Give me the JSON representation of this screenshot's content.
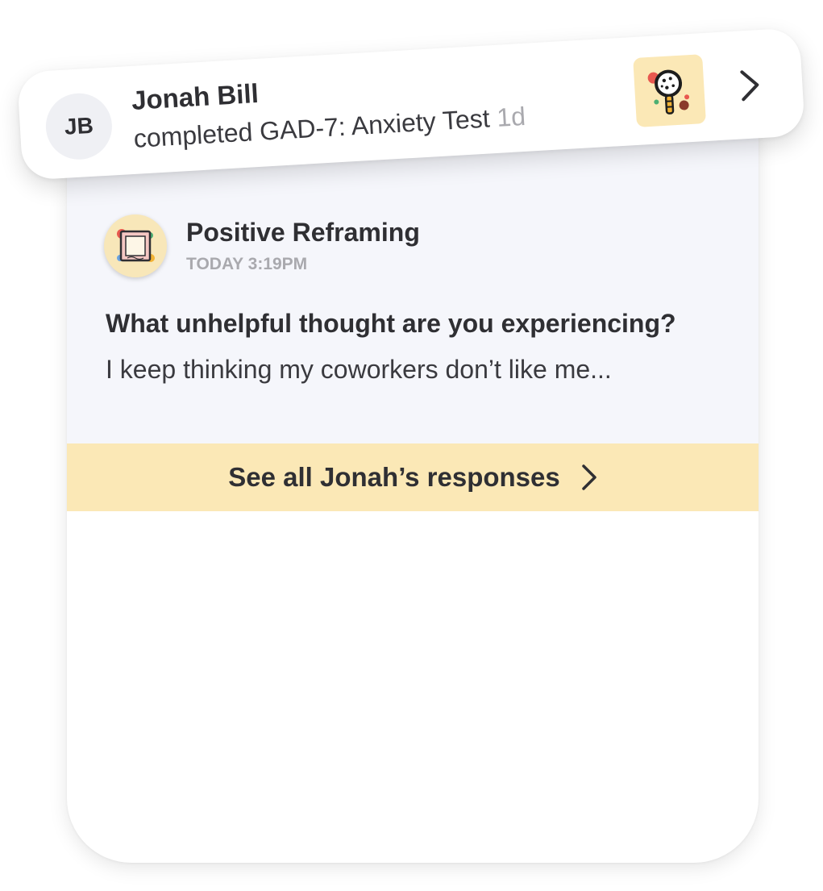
{
  "notification": {
    "avatar_initials": "JB",
    "name": "Jonah Bill",
    "action": "completed GAD-7: Anxiety Test",
    "time_ago": "1d",
    "thumbnail_icon": "magnifying-glass-illustration",
    "chevron_icon": "chevron-right-icon"
  },
  "activity": {
    "icon": "picture-frame-illustration",
    "title": "Positive Reframing",
    "timestamp": "TODAY 3:19PM",
    "question": "What unhelpful thought are you experiencing?",
    "answer": "I keep thinking my coworkers don’t like me..."
  },
  "see_all": {
    "label": "See all Jonah’s responses",
    "chevron_icon": "chevron-right-icon"
  },
  "colors": {
    "accent_yellow": "#fbe8b6",
    "card_top_bg": "#f5f6fb",
    "avatar_bg": "#eff0f4",
    "text_primary": "#2f2f33",
    "text_muted": "#a9a9ae"
  }
}
